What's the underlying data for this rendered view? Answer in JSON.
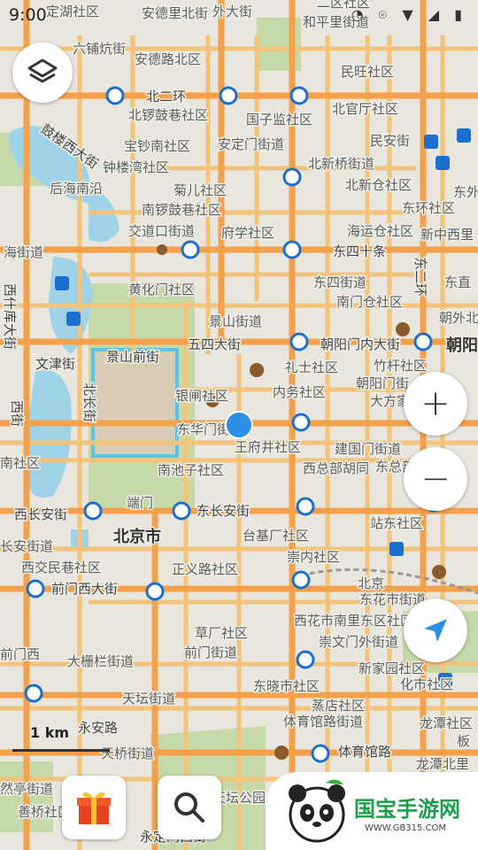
{
  "status_bar": {
    "time": "9:00",
    "icons": [
      "compass-icon",
      "location-icon",
      "wifi-icon",
      "signal-icon",
      "battery-icon"
    ]
  },
  "map": {
    "districts": [
      "定湖社区",
      "安德里北街",
      "外大街",
      "二区社区",
      "和平里街道",
      "六铺炕街",
      "安德路北区",
      "民旺社区",
      "北二环",
      "北锣鼓巷社区",
      "国子监社区",
      "北官厅社区",
      "民安街",
      "鼓楼西大街",
      "宝钞南社区",
      "安定门街道",
      "钟楼湾社区",
      "北新桥街道",
      "后海南沿",
      "菊儿社区",
      "北新仓社区",
      "东外",
      "南锣鼓巷社区",
      "东环社区",
      "交道口街道",
      "府学社区",
      "海运仓社区",
      "新中西里",
      "海街道",
      "东四十条",
      "东二环",
      "东四街道",
      "东直",
      "黄化门社区",
      "南门仓社区",
      "景山街道",
      "朝外北",
      "五四大街",
      "朝阳门内大街",
      "朝阳",
      "文津街",
      "景山前街",
      "礼士社区",
      "竹杆社区",
      "北长街",
      "银闸社区",
      "内务社区",
      "朝阳门街",
      "大方家社",
      "东华门街道",
      "王府井社区",
      "建国门街道",
      "南池子社区",
      "西总部胡同",
      "东总部社区",
      "南社区",
      "端门",
      "西长安街",
      "东长安街",
      "站东社区",
      "北京市",
      "长安街道",
      "台基厂社区",
      "崇内社区",
      "西交民巷社区",
      "正义路社区",
      "前门西大街",
      "北京",
      "东花市街道",
      "西花市南里东区社区",
      "草厂社区",
      "前门街道",
      "崇文门外街道",
      "大栅栏街道",
      "新家园社区",
      "天坛街道",
      "东晓市社区",
      "化市社区",
      "蒸店社区",
      "体育馆路街道",
      "龙潭社区",
      "永安路",
      "天桥街道",
      "体育馆路",
      "龙潭北里",
      "然亭街道",
      "天坛公园",
      "善桥社区",
      "永定门西街",
      "板",
      "西什库大街",
      "西街",
      "前门西"
    ]
  },
  "controls": {
    "layers_icon": "layers-icon",
    "zoom_in": "+",
    "zoom_out": "−",
    "locate_icon": "navigation-arrow-icon",
    "gift_icon": "gift-icon",
    "search_icon": "search-icon"
  },
  "scale": {
    "label": "1 km"
  },
  "watermark": {
    "name": "国宝手游网",
    "url": "WWW.GB315.COM",
    "mascot_icon": "panda-icon"
  },
  "colors": {
    "land": "#e8e6dd",
    "major_road": "#f5a04a",
    "minor_road": "#f3c37a",
    "water": "#9fd4e8",
    "park": "#c6d9a8",
    "location_dot": "#2f8fe8",
    "brand_green": "#1d9e4a"
  }
}
